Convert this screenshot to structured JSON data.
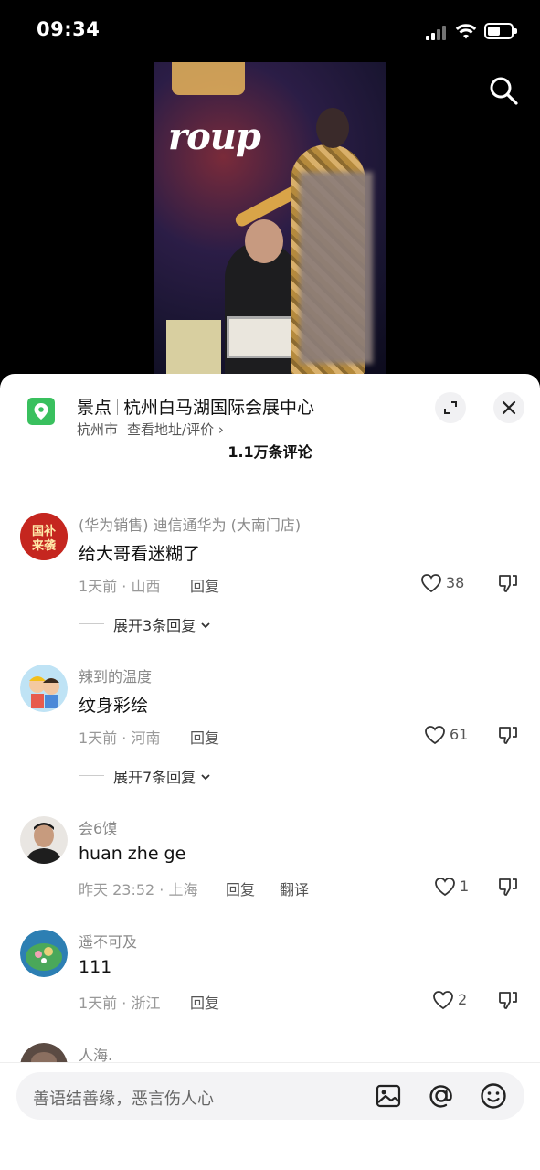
{
  "status_bar": {
    "time": "09:34"
  },
  "location": {
    "category": "景点",
    "name": "杭州白马湖国际会展中心",
    "city": "杭州市",
    "link_text": "查看地址/评价 ›"
  },
  "comments_header": {
    "count_label": "1.1万条评论"
  },
  "comments": [
    {
      "username": "(华为销售) 迪信通华为 (大南门店)",
      "avatar_text": "国补\n来袭",
      "text": "给大哥看迷糊了",
      "meta": "1天前 · 山西",
      "reply_label": "回复",
      "likes": "38",
      "expand_label": "展开3条回复"
    },
    {
      "username": "辣到的温度",
      "text": "纹身彩绘",
      "meta": "1天前 · 河南",
      "reply_label": "回复",
      "likes": "61",
      "expand_label": "展开7条回复"
    },
    {
      "username": "会6馍",
      "text": "huan zhe ge",
      "meta": "昨天 23:52 · 上海",
      "reply_label": "回复",
      "translate_label": "翻译",
      "likes": "1"
    },
    {
      "username": "遥不可及",
      "text": "111",
      "meta": "1天前 · 浙江",
      "reply_label": "回复",
      "likes": "2"
    },
    {
      "username": "人海."
    }
  ],
  "input_bar": {
    "placeholder": "善语结善缘，恶言伤人心"
  },
  "colors": {
    "location_green": "#39c05e",
    "sheet_bg": "#ffffff",
    "input_bg": "#f3f3f5"
  },
  "icons": [
    "search-icon",
    "location-pin-icon",
    "expand-icon",
    "close-icon",
    "heart-icon",
    "dislike-icon",
    "chevron-down-icon",
    "image-icon",
    "at-icon",
    "emoji-icon"
  ]
}
